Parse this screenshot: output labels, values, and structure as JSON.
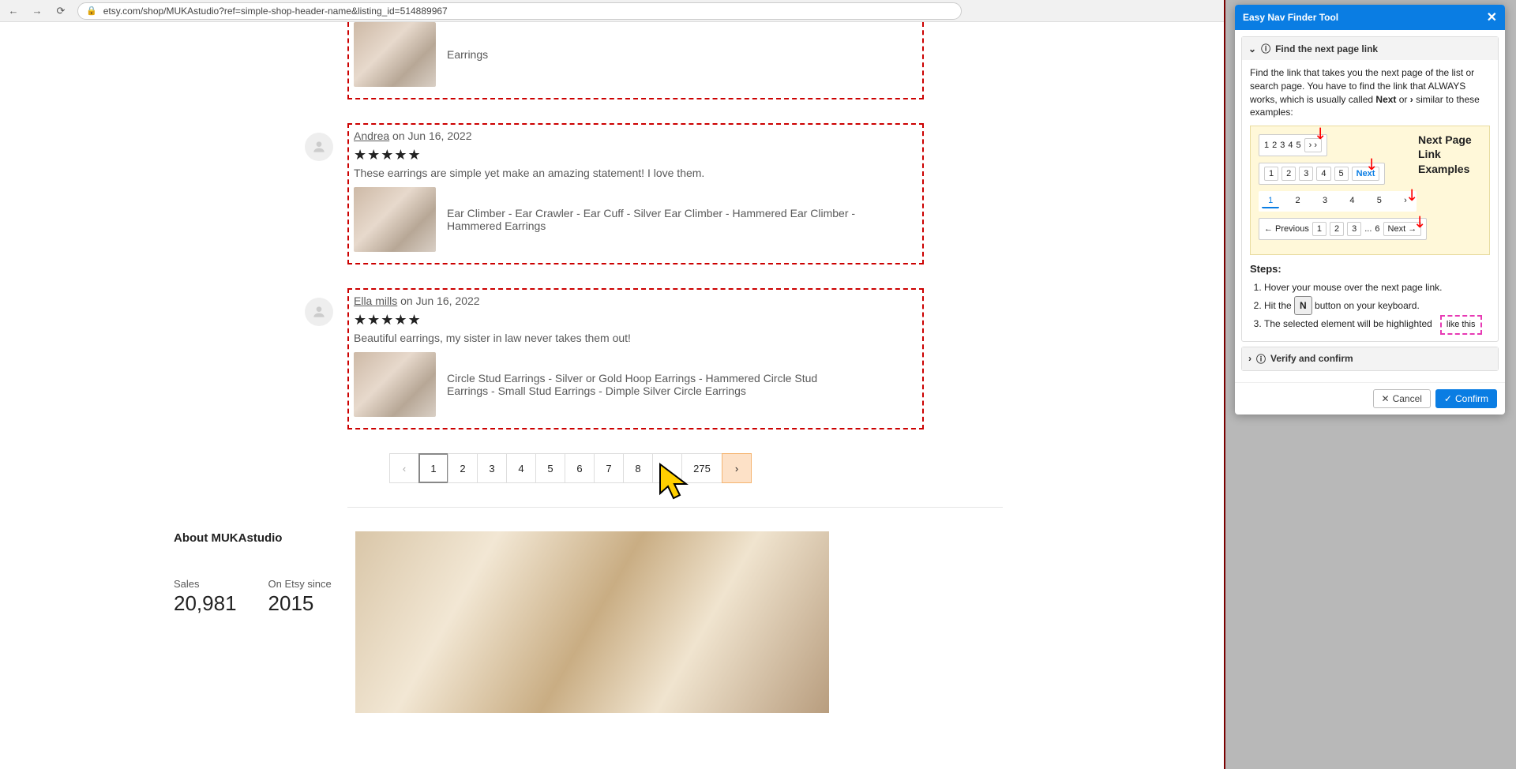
{
  "browser": {
    "url": "etsy.com/shop/MUKAstudio?ref=simple-shop-header-name&listing_id=514889967"
  },
  "reviews": [
    {
      "product": "Earrings"
    },
    {
      "author": "Andrea",
      "date_prefix": "on",
      "date": "Jun 16, 2022",
      "stars": "★★★★★",
      "text": "These earrings are simple yet make an amazing statement! I love them.",
      "product": "Ear Climber - Ear Crawler - Ear Cuff - Silver Ear Climber - Hammered Ear Climber - Hammered Earrings"
    },
    {
      "author": "Ella mills",
      "date_prefix": "on",
      "date": "Jun 16, 2022",
      "stars": "★★★★★",
      "text": "Beautiful earrings, my sister in law never takes them out!",
      "product": "Circle Stud Earrings - Silver or Gold Hoop Earrings - Hammered Circle Stud Earrings - Small Stud Earrings - Dimple Silver Circle Earrings"
    }
  ],
  "pagination": {
    "prev": "‹",
    "pages": [
      "1",
      "2",
      "3",
      "4",
      "5",
      "6",
      "7",
      "8",
      "...",
      "275"
    ],
    "next": "›"
  },
  "about": {
    "title": "About MUKAstudio",
    "sales_label": "Sales",
    "sales_value": "20,981",
    "since_label": "On Etsy since",
    "since_value": "2015"
  },
  "tool": {
    "title": "Easy Nav Finder Tool",
    "section1": "Find the next page link",
    "instructions_a": "Find the link that takes you the next page of the list or search page. You have to find the link that ALWAYS works, which is usually called ",
    "instructions_b": "Next",
    "instructions_c": " or ",
    "instructions_d": " similar to these examples:",
    "examples_title": "Next Page Link Examples",
    "ex1": {
      "p": [
        "1",
        "2",
        "3",
        "4",
        "5"
      ],
      "next": "› ›"
    },
    "ex2": {
      "p": [
        "1",
        "2",
        "3",
        "4",
        "5"
      ],
      "next": "Next"
    },
    "ex3": {
      "p": [
        "1",
        "2",
        "3",
        "4",
        "5"
      ],
      "next": "›"
    },
    "ex4": {
      "prev": "←  Previous",
      "p": [
        "1",
        "2",
        "3",
        "...",
        "6"
      ],
      "next": "Next  →"
    },
    "steps_title": "Steps:",
    "step1": "Hover your mouse over the next page link.",
    "step2a": "Hit the ",
    "step2key": "N",
    "step2b": " button on your keyboard.",
    "step3a": "The selected element will be highlighted",
    "step3b": "like this",
    "section2": "Verify and confirm",
    "cancel": "Cancel",
    "confirm": "Confirm"
  }
}
